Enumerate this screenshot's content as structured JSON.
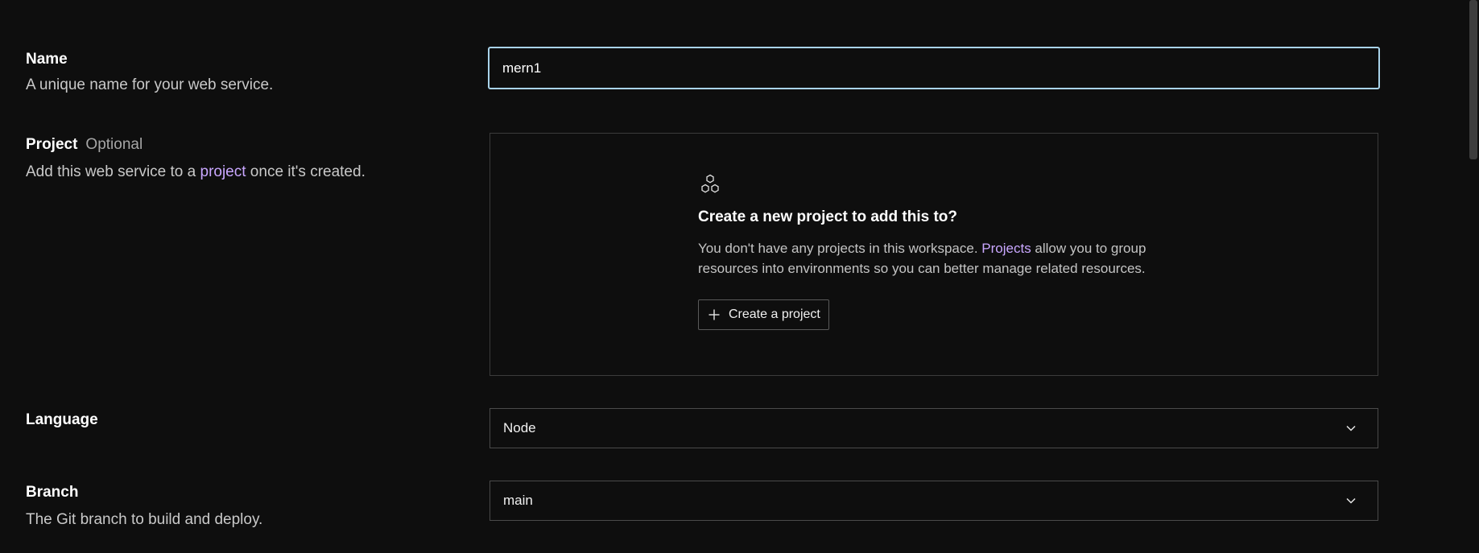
{
  "name_field": {
    "title": "Name",
    "description": "A unique name for your web service.",
    "value": "mern1"
  },
  "project_field": {
    "title": "Project",
    "optional": "Optional",
    "description_before": "Add this web service to a ",
    "description_link": "project",
    "description_after": " once it's created.",
    "empty_state": {
      "icon": "hexagons-icon",
      "title": "Create a new project to add this to?",
      "desc_before": "You don't have any projects in this workspace. ",
      "desc_link": "Projects",
      "desc_after": " allow you to group resources into environments so you can better manage related resources.",
      "button_label": "Create a project",
      "button_icon": "plus-icon"
    }
  },
  "language_field": {
    "title": "Language",
    "value": "Node"
  },
  "branch_field": {
    "title": "Branch",
    "description": "The Git branch to build and deploy.",
    "value": "main"
  },
  "colors": {
    "background": "#0e0e0e",
    "focus_border": "#a9d3ea",
    "link": "#c9a7ff"
  }
}
